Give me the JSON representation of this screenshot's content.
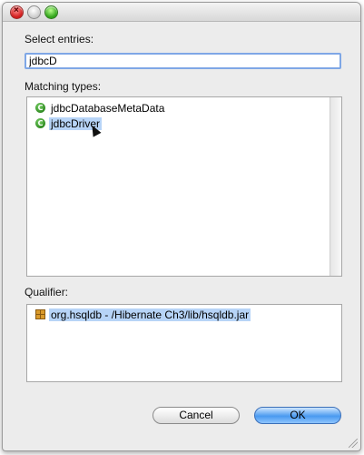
{
  "window": {
    "title": ""
  },
  "select_entries": {
    "label": "Select entries:",
    "value": "jdbcD"
  },
  "matching_types": {
    "label": "Matching types:",
    "items": [
      {
        "name": "jdbcDatabaseMetaData",
        "icon": "class-icon",
        "selected": false
      },
      {
        "name": "jdbcDriver",
        "icon": "class-icon",
        "selected": true
      }
    ]
  },
  "qualifier": {
    "label": "Qualifier:",
    "items": [
      {
        "name": "org.hsqldb - /Hibernate Ch3/lib/hsqldb.jar",
        "icon": "jar-icon",
        "selected": true
      }
    ]
  },
  "buttons": {
    "cancel": "Cancel",
    "ok": "OK"
  },
  "colors": {
    "selection": "#b7d4f7",
    "default_button": "#4a9af0",
    "focus_ring": "#7fa7e6"
  }
}
